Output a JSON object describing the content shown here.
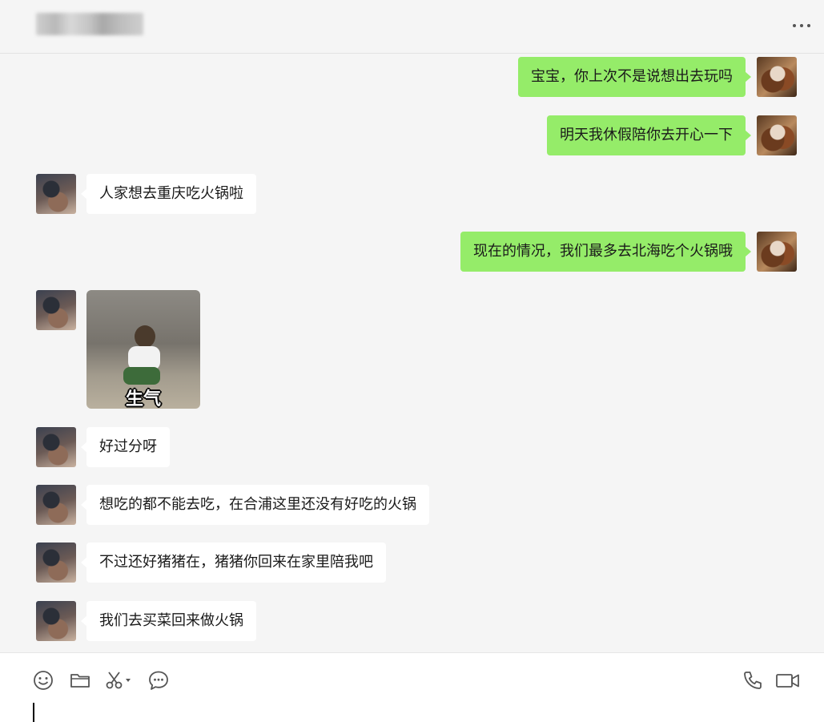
{
  "header": {
    "title": "",
    "more_icon": "more-horizontal-icon"
  },
  "messages": [
    {
      "side": "right",
      "type": "text",
      "text": "宝宝，你上次不是说想出去玩吗"
    },
    {
      "side": "right",
      "type": "text",
      "text": "明天我休假陪你去开心一下"
    },
    {
      "side": "left",
      "type": "text",
      "text": "人家想去重庆吃火锅啦"
    },
    {
      "side": "right",
      "type": "text",
      "text": "现在的情况，我们最多去北海吃个火锅哦"
    },
    {
      "side": "left",
      "type": "sticker",
      "caption": "生气"
    },
    {
      "side": "left",
      "type": "text",
      "text": "好过分呀"
    },
    {
      "side": "left",
      "type": "text",
      "text": "想吃的都不能去吃，在合浦这里还没有好吃的火锅"
    },
    {
      "side": "left",
      "type": "text",
      "text": "不过还好猪猪在，猪猪你回来在家里陪我吧"
    },
    {
      "side": "left",
      "type": "text",
      "text": "我们去买菜回来做火锅"
    }
  ],
  "toolbar": {
    "icons": [
      "emoji-icon",
      "folder-icon",
      "scissors-icon",
      "chat-history-icon",
      "phone-icon",
      "video-call-icon"
    ]
  },
  "input": {
    "value": ""
  },
  "colors": {
    "my_bubble": "#95ec69",
    "other_bubble": "#ffffff",
    "background": "#f5f5f5"
  }
}
